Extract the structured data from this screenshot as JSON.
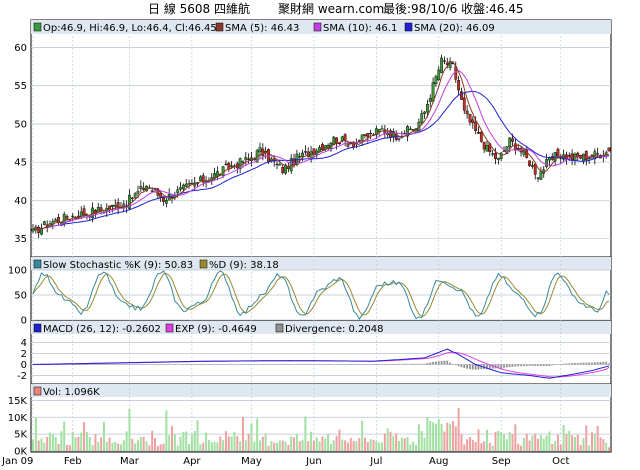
{
  "header": {
    "title": "日 線 5608 四維航",
    "site": "聚財網 wearn.com",
    "summary": "最後:98/10/6 收盤:46.45"
  },
  "legends": {
    "price": [
      {
        "label": "Op:46.9, Hi:46.9, Lo:46.4, Cl:46.45",
        "color": "#3a9a3a"
      },
      {
        "label": "SMA (5): 46.43",
        "color": "#8b3a2a"
      },
      {
        "label": "SMA (10): 46.1",
        "color": "#c040e0"
      },
      {
        "label": "SMA (20): 46.09",
        "color": "#2020d0"
      }
    ],
    "stoch": [
      {
        "label": "Slow Stochastic %K (9): 50.83",
        "color": "#3a8a9a"
      },
      {
        "label": "%D (9): 38.18",
        "color": "#9a8a30"
      }
    ],
    "macd": [
      {
        "label": "MACD (26, 12): -0.2602",
        "color": "#2020d0"
      },
      {
        "label": "EXP (9): -0.4649",
        "color": "#e040e0"
      },
      {
        "label": "Divergence: 0.2048",
        "color": "#909090"
      }
    ],
    "vol": [
      {
        "label": "Vol: 1.096K",
        "color": "#f08080"
      }
    ]
  },
  "colors": {
    "up": "#3a9a3a",
    "down": "#c03020",
    "panel_header": "#dfe8f0",
    "grid": "#b8c4d0",
    "vol_up": "#a0e0a0",
    "vol_down": "#f0a0a0"
  },
  "axes": {
    "price_ticks": [
      "60",
      "55",
      "50",
      "45",
      "40",
      "35"
    ],
    "stoch_ticks": [
      "100",
      "50",
      "0"
    ],
    "macd_ticks": [
      "4",
      "2",
      "0",
      "-2"
    ],
    "vol_ticks": [
      "15K",
      "10K",
      "5K",
      "0K"
    ],
    "months": [
      "Jan 09",
      "Feb",
      "Mar",
      "Apr",
      "May",
      "Jun",
      "Jul",
      "Aug",
      "Sep",
      "Oct"
    ]
  },
  "chart_data": {
    "type": "candlestick",
    "x_range": [
      "Jan 09",
      "Oct 6"
    ],
    "price_ylim": [
      33,
      61.5
    ],
    "price_keypoints": [
      [
        0,
        35.8
      ],
      [
        5,
        37
      ],
      [
        12,
        37.8
      ],
      [
        20,
        38.5
      ],
      [
        27,
        39
      ],
      [
        33,
        39.8
      ],
      [
        40,
        42
      ],
      [
        46,
        40.2
      ],
      [
        54,
        41.7
      ],
      [
        62,
        43
      ],
      [
        70,
        44.5
      ],
      [
        76,
        45.4
      ],
      [
        80,
        46.5
      ],
      [
        88,
        44
      ],
      [
        93,
        45.5
      ],
      [
        100,
        46.8
      ],
      [
        106,
        48
      ],
      [
        113,
        47.5
      ],
      [
        118,
        48.4
      ],
      [
        123,
        49.3
      ],
      [
        128,
        48.5
      ],
      [
        135,
        49.6
      ],
      [
        138,
        51.6
      ],
      [
        141,
        55
      ],
      [
        144,
        58.2
      ],
      [
        148,
        57.5
      ],
      [
        152,
        51.5
      ],
      [
        156,
        49
      ],
      [
        160,
        46.7
      ],
      [
        164,
        45.3
      ],
      [
        168,
        47.8
      ],
      [
        171,
        46.9
      ],
      [
        175,
        45
      ],
      [
        178,
        43.3
      ],
      [
        181,
        44.8
      ],
      [
        185,
        46
      ],
      [
        190,
        45.6
      ],
      [
        196,
        45.8
      ],
      [
        200,
        46.1
      ],
      [
        203,
        46.45
      ]
    ],
    "last_candle": {
      "open": 46.9,
      "high": 46.9,
      "low": 46.4,
      "close": 46.45
    },
    "sma": {
      "5": 46.43,
      "10": 46.1,
      "20": 46.09
    },
    "stochastic": {
      "ylim": [
        0,
        100
      ],
      "k_last": 50.83,
      "d_last": 38.18
    },
    "macd": {
      "ylim": [
        -3,
        5
      ],
      "macd_last": -0.2602,
      "signal_last": -0.4649,
      "divergence_last": 0.2048,
      "keypoints": [
        [
          0,
          0
        ],
        [
          30,
          0.3
        ],
        [
          60,
          0.6
        ],
        [
          90,
          0.7
        ],
        [
          120,
          0.6
        ],
        [
          138,
          1.2
        ],
        [
          146,
          2.8
        ],
        [
          150,
          1.8
        ],
        [
          156,
          0
        ],
        [
          165,
          -1.5
        ],
        [
          175,
          -2.0
        ],
        [
          182,
          -2.5
        ],
        [
          190,
          -1.8
        ],
        [
          197,
          -1.1
        ],
        [
          203,
          -0.26
        ]
      ]
    },
    "volume": {
      "ylim": [
        0,
        16000
      ],
      "last": 1096
    }
  }
}
